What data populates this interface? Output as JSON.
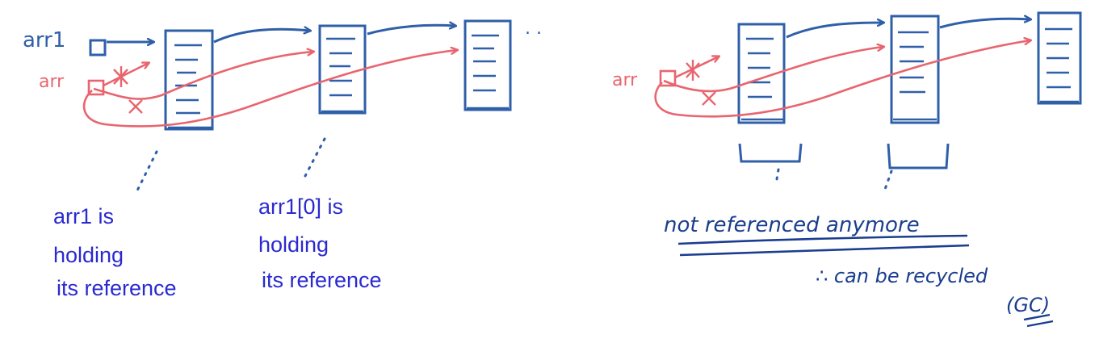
{
  "colors": {
    "blue": "#2f5fa8",
    "red": "#e8656f",
    "text_blue": "#2a2ad0",
    "handwriting": "#1a3d8f"
  },
  "labels": {
    "arr1": "arr1",
    "arr": "arr",
    "arr_right": "arr",
    "ellipsis": ". .",
    "note_left_1": "arr1 is",
    "note_left_2": "holding",
    "note_left_3": "its reference",
    "note_mid_1": "arr1[0] is",
    "note_mid_2": "holding",
    "note_mid_3": "its reference",
    "not_referenced": "not referenced anymore",
    "can_be_recycled": "∴ can be recycled",
    "gc": "(GC)"
  }
}
